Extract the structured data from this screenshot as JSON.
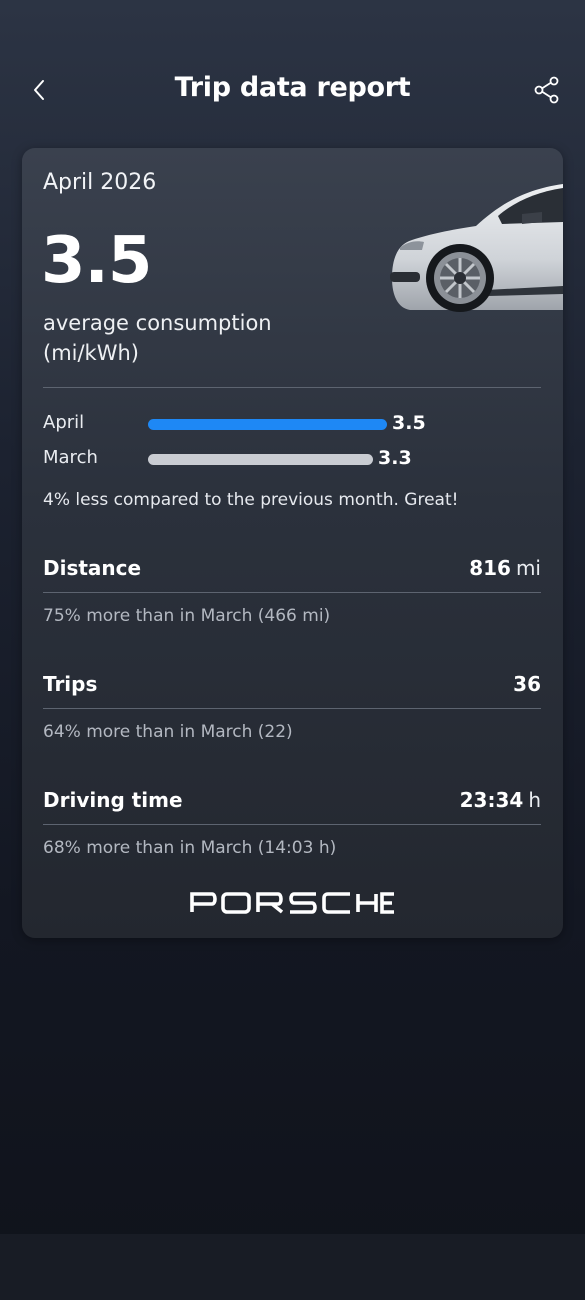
{
  "header": {
    "title": "Trip data report",
    "back_icon": "chevron-left-icon",
    "share_icon": "share-icon"
  },
  "report": {
    "period": "April 2026",
    "average_consumption": "3.5",
    "consumption_label": "average consumption (mi/kWh)",
    "comparison": [
      {
        "label": "April",
        "value": "3.5",
        "fraction": 1.0,
        "color": "#1e88f5"
      },
      {
        "label": "March",
        "value": "3.3",
        "fraction": 0.94,
        "color": "#c9ccd2"
      }
    ],
    "comparison_note": "4% less compared to the previous month. Great!",
    "stats": {
      "distance": {
        "label": "Distance",
        "value": "816",
        "unit": "mi",
        "note": "75% more than in March (466 mi)"
      },
      "trips": {
        "label": "Trips",
        "value": "36",
        "unit": "",
        "note": "64% more than in March (22)"
      },
      "driving_time": {
        "label": "Driving time",
        "value": "23:34",
        "unit": "h",
        "note": "68% more than in March (14:03 h)"
      }
    },
    "brand": "PORSCHE"
  },
  "colors": {
    "accent": "#1e88f5",
    "previous_bar": "#c9ccd2",
    "background": "#1c2230"
  }
}
